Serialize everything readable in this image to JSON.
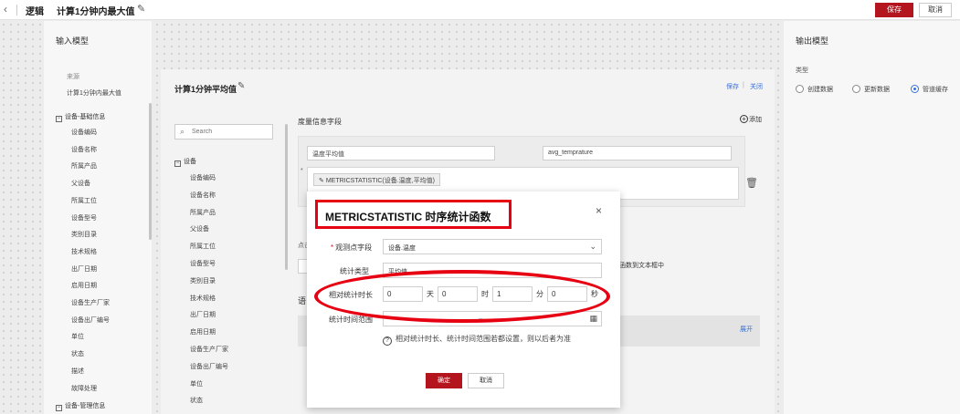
{
  "topbar": {
    "app_name": "逻辑",
    "title": "计算1分钟内最大值",
    "save_label": "保存",
    "cancel_label": "取消"
  },
  "input_model": {
    "header": "输入模型",
    "source_label": "来源",
    "source_value": "计算1分钟内最大值",
    "group1": "设备-基础信息",
    "group1_items": [
      "设备编码",
      "设备名称",
      "所属产品",
      "父设备",
      "所属工位",
      "设备型号",
      "类别目录",
      "技术规格",
      "出厂日期",
      "启用日期",
      "设备生产厂家",
      "设备出厂编号",
      "单位",
      "状态",
      "描述",
      "故障处理"
    ],
    "group2": "设备-管理信息"
  },
  "output_model": {
    "header": "输出模型",
    "type_label": "类型",
    "options": [
      "创建数据",
      "更新数据",
      "管道缓存"
    ],
    "selected": "管道缓存"
  },
  "card": {
    "title": "计算1分钟平均值",
    "save_link": "保存",
    "divider": "|",
    "close_link": "关闭",
    "search_placeholder": "Search",
    "tree_group": "设备",
    "tree_items": [
      "设备编码",
      "设备名称",
      "所属产品",
      "父设备",
      "所属工位",
      "设备型号",
      "类别目录",
      "技术规格",
      "出厂日期",
      "启用日期",
      "设备生产厂家",
      "设备出厂编号",
      "单位",
      "状态"
    ],
    "measure_title": "度量信息字段",
    "add_label": "添加",
    "field_name": "温度平均值",
    "field_key": "avg_temprature",
    "expression_tag": "METRICSTATISTIC(设备.温度,平均值)",
    "asterisk": "*",
    "label_point": "点击",
    "label_lang": "语",
    "hint_right": "函数到文本框中",
    "expand": "展开"
  },
  "modal": {
    "title": "METRICSTATISTIC 时序统计函数",
    "point_label": "观测点字段",
    "point_value": "设备.温度",
    "stat_type_label": "统计类型",
    "stat_type_value": "平均值",
    "duration_label": "相对统计时长",
    "days": "0",
    "hours": "0",
    "minutes": "1",
    "seconds": "0",
    "unit_day": "天",
    "unit_hour": "时",
    "unit_minute": "分",
    "unit_second": "秒",
    "range_label": "统计时间范围",
    "range_separator": "–",
    "tip": "相对统计时长、统计时间范围若都设置，则以后者为准",
    "ok_label": "确定",
    "cancel_label": "取消"
  },
  "colors": {
    "primary": "#b4141e",
    "annotation": "#e60012",
    "link": "#3a6fd8"
  }
}
